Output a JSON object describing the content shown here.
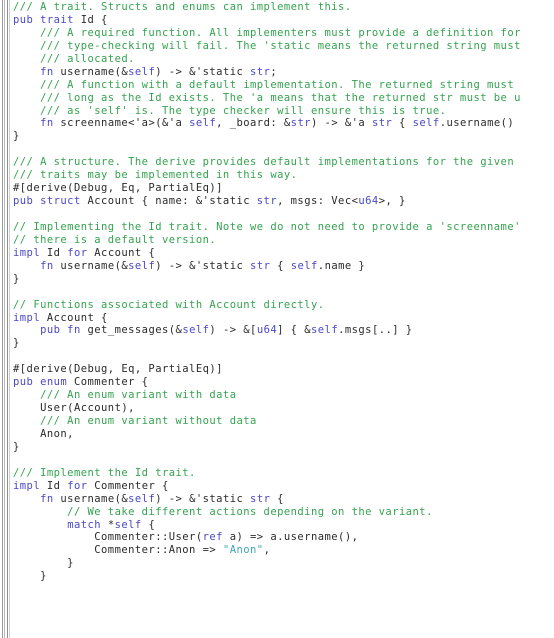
{
  "editor": {
    "language": "rust",
    "background": "#ffffff",
    "colors": {
      "comment": "#35a350",
      "keyword": "#4a48c8",
      "string": "#3fa8b5",
      "text": "#2b2b2b",
      "gutter_rule": "#9a9a9a"
    },
    "gutter": {
      "name": "vertical-scrollbar-rules",
      "rule_count": 4
    }
  },
  "code": {
    "lines": [
      [
        {
          "t": "/// A trait. Structs and enums can implement this.",
          "c": "cm"
        }
      ],
      [
        {
          "t": "pub trait",
          "c": "kw"
        },
        {
          "t": " Id {",
          "c": "tx"
        }
      ],
      [
        {
          "t": "    /// A required function. All implementers must provide a definition for",
          "c": "cm"
        }
      ],
      [
        {
          "t": "    /// type-checking will fail. The 'static means the returned string must",
          "c": "cm"
        }
      ],
      [
        {
          "t": "    /// allocated.",
          "c": "cm"
        }
      ],
      [
        {
          "t": "    ",
          "c": "tx"
        },
        {
          "t": "fn",
          "c": "kw"
        },
        {
          "t": " username(&",
          "c": "tx"
        },
        {
          "t": "self",
          "c": "kw"
        },
        {
          "t": ") -> &'static ",
          "c": "tx"
        },
        {
          "t": "str",
          "c": "kw"
        },
        {
          "t": ";",
          "c": "tx"
        }
      ],
      [
        {
          "t": "    /// A function with a default implementation. The returned string must",
          "c": "cm"
        }
      ],
      [
        {
          "t": "    /// long as the Id exists. The 'a means that the returned str must be u",
          "c": "cm"
        }
      ],
      [
        {
          "t": "    /// as 'self' is. The type checker will ensure this is true.",
          "c": "cm"
        }
      ],
      [
        {
          "t": "    ",
          "c": "tx"
        },
        {
          "t": "fn",
          "c": "kw"
        },
        {
          "t": " screenname<'a>(&'a ",
          "c": "tx"
        },
        {
          "t": "self",
          "c": "kw"
        },
        {
          "t": ", _board: &",
          "c": "tx"
        },
        {
          "t": "str",
          "c": "kw"
        },
        {
          "t": ") -> &'a ",
          "c": "tx"
        },
        {
          "t": "str",
          "c": "kw"
        },
        {
          "t": " { ",
          "c": "tx"
        },
        {
          "t": "self",
          "c": "kw"
        },
        {
          "t": ".username()",
          "c": "tx"
        }
      ],
      [
        {
          "t": "}",
          "c": "tx"
        }
      ],
      [
        {
          "t": "",
          "c": "tx"
        }
      ],
      [
        {
          "t": "/// A structure. The derive provides default implementations for the given",
          "c": "cm"
        }
      ],
      [
        {
          "t": "/// traits may be implemented in this way.",
          "c": "cm"
        }
      ],
      [
        {
          "t": "#[derive(Debug, Eq, PartialEq)]",
          "c": "tx"
        }
      ],
      [
        {
          "t": "pub struct",
          "c": "kw"
        },
        {
          "t": " Account { name: &'static ",
          "c": "tx"
        },
        {
          "t": "str",
          "c": "kw"
        },
        {
          "t": ", msgs: Vec<",
          "c": "tx"
        },
        {
          "t": "u64",
          "c": "kw"
        },
        {
          "t": ">, }",
          "c": "tx"
        }
      ],
      [
        {
          "t": "",
          "c": "tx"
        }
      ],
      [
        {
          "t": "// Implementing the Id trait. Note we do not need to provide a 'screenname'",
          "c": "cm"
        }
      ],
      [
        {
          "t": "// there is a default version.",
          "c": "cm"
        }
      ],
      [
        {
          "t": "impl",
          "c": "kw"
        },
        {
          "t": " Id ",
          "c": "tx"
        },
        {
          "t": "for",
          "c": "kw"
        },
        {
          "t": " Account {",
          "c": "tx"
        }
      ],
      [
        {
          "t": "    ",
          "c": "tx"
        },
        {
          "t": "fn",
          "c": "kw"
        },
        {
          "t": " username(&",
          "c": "tx"
        },
        {
          "t": "self",
          "c": "kw"
        },
        {
          "t": ") -> &'static ",
          "c": "tx"
        },
        {
          "t": "str",
          "c": "kw"
        },
        {
          "t": " { ",
          "c": "tx"
        },
        {
          "t": "self",
          "c": "kw"
        },
        {
          "t": ".name }",
          "c": "tx"
        }
      ],
      [
        {
          "t": "}",
          "c": "tx"
        }
      ],
      [
        {
          "t": "",
          "c": "tx"
        }
      ],
      [
        {
          "t": "// Functions associated with Account directly.",
          "c": "cm"
        }
      ],
      [
        {
          "t": "impl",
          "c": "kw"
        },
        {
          "t": " Account {",
          "c": "tx"
        }
      ],
      [
        {
          "t": "    ",
          "c": "tx"
        },
        {
          "t": "pub fn",
          "c": "kw"
        },
        {
          "t": " get_messages(&",
          "c": "tx"
        },
        {
          "t": "self",
          "c": "kw"
        },
        {
          "t": ") -> &[",
          "c": "tx"
        },
        {
          "t": "u64",
          "c": "kw"
        },
        {
          "t": "] { &",
          "c": "tx"
        },
        {
          "t": "self",
          "c": "kw"
        },
        {
          "t": ".msgs[..] }",
          "c": "tx"
        }
      ],
      [
        {
          "t": "}",
          "c": "tx"
        }
      ],
      [
        {
          "t": "",
          "c": "tx"
        }
      ],
      [
        {
          "t": "#[derive(Debug, Eq, PartialEq)]",
          "c": "tx"
        }
      ],
      [
        {
          "t": "pub enum",
          "c": "kw"
        },
        {
          "t": " Commenter {",
          "c": "tx"
        }
      ],
      [
        {
          "t": "    /// An enum variant with data",
          "c": "cm"
        }
      ],
      [
        {
          "t": "    User(Account),",
          "c": "tx"
        }
      ],
      [
        {
          "t": "    /// An enum variant without data",
          "c": "cm"
        }
      ],
      [
        {
          "t": "    Anon,",
          "c": "tx"
        }
      ],
      [
        {
          "t": "}",
          "c": "tx"
        }
      ],
      [
        {
          "t": "",
          "c": "tx"
        }
      ],
      [
        {
          "t": "/// Implement the Id trait.",
          "c": "cm"
        }
      ],
      [
        {
          "t": "impl",
          "c": "kw"
        },
        {
          "t": " Id ",
          "c": "tx"
        },
        {
          "t": "for",
          "c": "kw"
        },
        {
          "t": " Commenter {",
          "c": "tx"
        }
      ],
      [
        {
          "t": "    ",
          "c": "tx"
        },
        {
          "t": "fn",
          "c": "kw"
        },
        {
          "t": " username(&",
          "c": "tx"
        },
        {
          "t": "self",
          "c": "kw"
        },
        {
          "t": ") -> &'static ",
          "c": "tx"
        },
        {
          "t": "str",
          "c": "kw"
        },
        {
          "t": " {",
          "c": "tx"
        }
      ],
      [
        {
          "t": "        // We take different actions depending on the variant.",
          "c": "cm"
        }
      ],
      [
        {
          "t": "        ",
          "c": "tx"
        },
        {
          "t": "match",
          "c": "kw"
        },
        {
          "t": " *",
          "c": "tx"
        },
        {
          "t": "self",
          "c": "kw"
        },
        {
          "t": " {",
          "c": "tx"
        }
      ],
      [
        {
          "t": "            Commenter::User(",
          "c": "tx"
        },
        {
          "t": "ref",
          "c": "kw"
        },
        {
          "t": " a) => a.username(),",
          "c": "tx"
        }
      ],
      [
        {
          "t": "            Commenter::Anon => ",
          "c": "tx"
        },
        {
          "t": "\"Anon\"",
          "c": "st"
        },
        {
          "t": ",",
          "c": "tx"
        }
      ],
      [
        {
          "t": "        }",
          "c": "tx"
        }
      ],
      [
        {
          "t": "    }",
          "c": "tx"
        }
      ]
    ]
  }
}
